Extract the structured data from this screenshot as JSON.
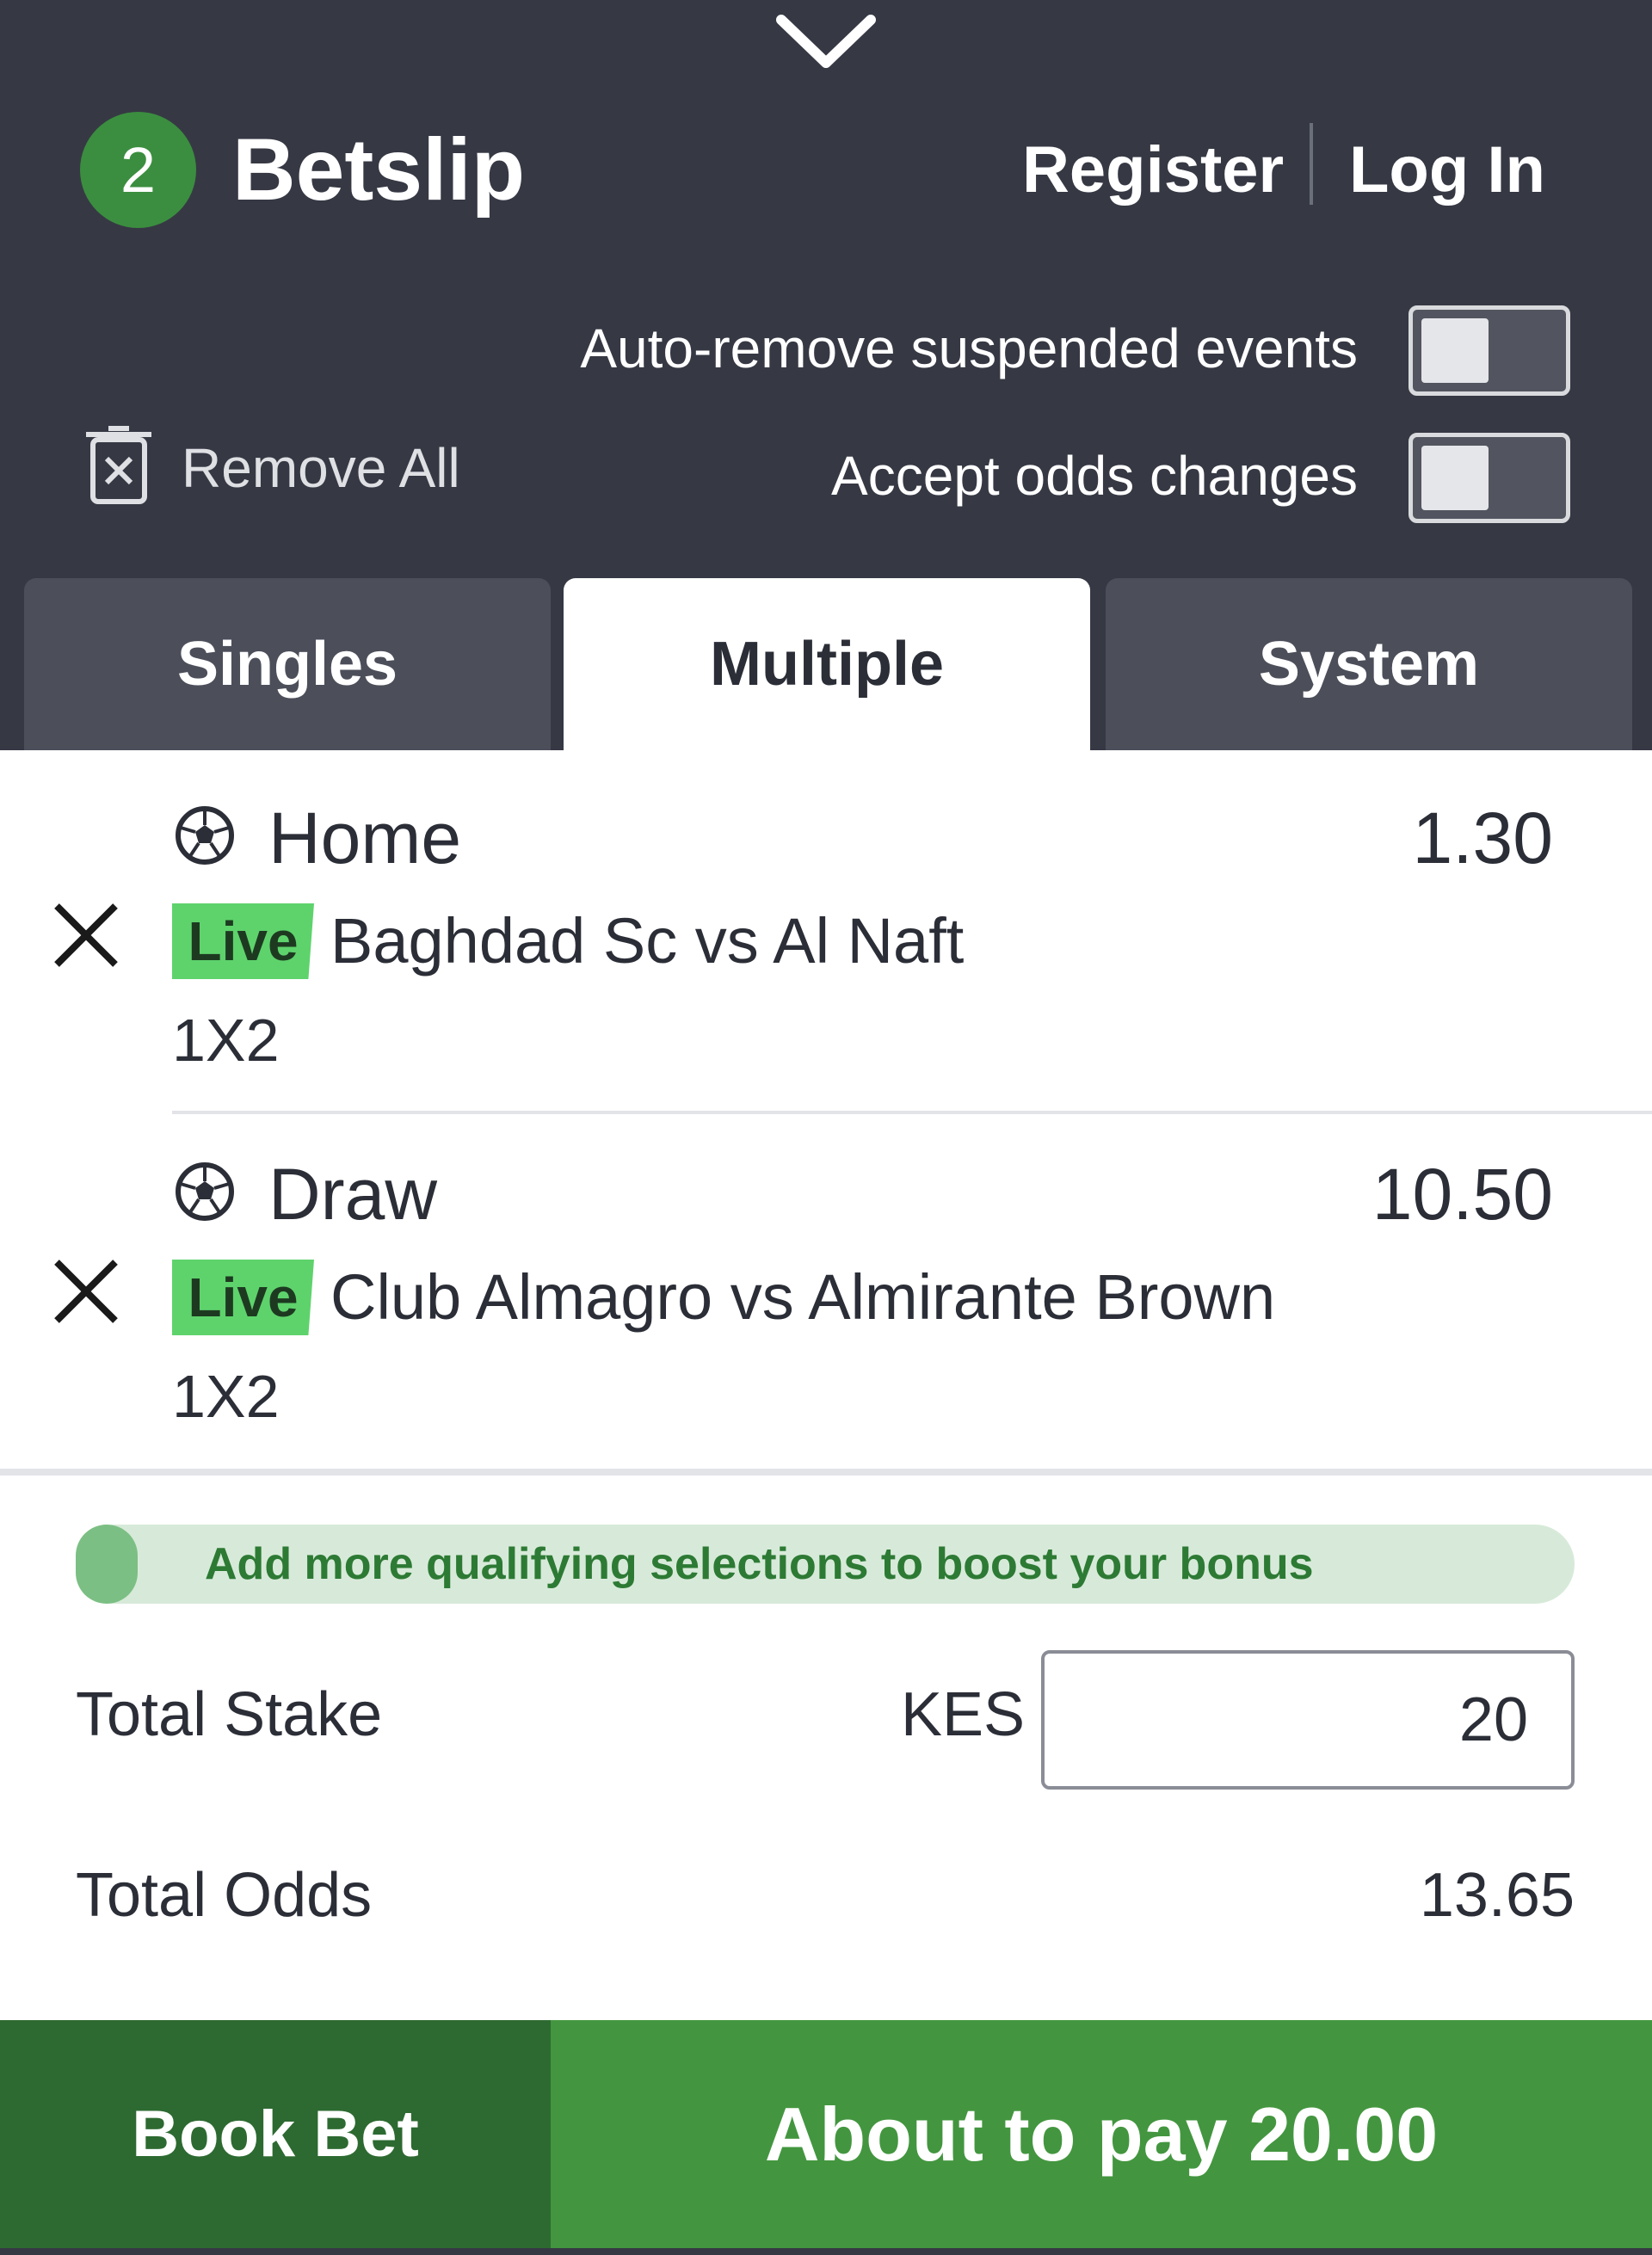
{
  "header": {
    "count": "2",
    "title": "Betslip",
    "register": "Register",
    "login": "Log In"
  },
  "options": {
    "auto_remove_label": "Auto-remove suspended events",
    "auto_remove_on": false,
    "accept_odds_label": "Accept odds changes",
    "accept_odds_on": false,
    "remove_all": "Remove All"
  },
  "tabs": [
    {
      "label": "Singles",
      "active": false
    },
    {
      "label": "Multiple",
      "active": true
    },
    {
      "label": "System",
      "active": false
    }
  ],
  "selections": [
    {
      "pick": "Home",
      "odds": "1.30",
      "live_badge": "Live",
      "event": "Baghdad Sc vs Al Naft",
      "market": "1X2",
      "icon": "soccer-ball-icon"
    },
    {
      "pick": "Draw",
      "odds": "10.50",
      "live_badge": "Live",
      "event": "Club Almagro vs Almirante Brown",
      "market": "1X2",
      "icon": "soccer-ball-icon"
    }
  ],
  "bonus": {
    "message": "Add more qualifying selections to boost your bonus",
    "progress": 0.04
  },
  "summary": {
    "total_stake_label": "Total Stake",
    "currency": "KES",
    "stake_value": "20",
    "total_odds_label": "Total Odds",
    "total_odds_value": "13.65"
  },
  "actions": {
    "book_bet": "Book Bet",
    "pay": "About to pay 20.00"
  },
  "colors": {
    "header_bg": "#363944",
    "accent_green": "#43963f",
    "live_green": "#5ed36c"
  }
}
